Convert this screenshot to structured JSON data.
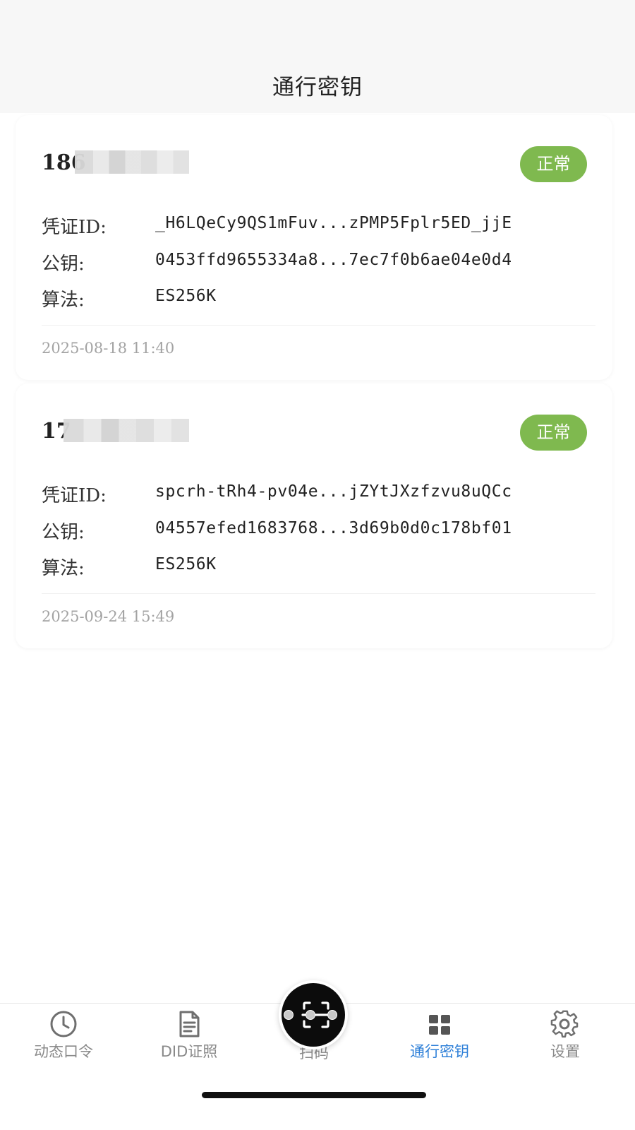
{
  "header": {
    "title": "通行密钥"
  },
  "cards": [
    {
      "account": "186",
      "status": "正常",
      "credential_label": "凭证ID:",
      "credential_id": "_H6LQeCy9QS1mFuv...zPMP5Fplr5ED_jjE",
      "pubkey_label": "公钥:",
      "pubkey": "0453ffd9655334a8...7ec7f0b6ae04e0d4",
      "algo_label": "算法:",
      "algo": "ES256K",
      "timestamp": "2025-08-18 11:40"
    },
    {
      "account": "17",
      "status": "正常",
      "credential_label": "凭证ID:",
      "credential_id": "spcrh-tRh4-pv04e...jZYtJXzfzvu8uQCc",
      "pubkey_label": "公钥:",
      "pubkey": "04557efed1683768...3d69b0d0c178bf01",
      "algo_label": "算法:",
      "algo": "ES256K",
      "timestamp": "2025-09-24 15:49"
    }
  ],
  "tabbar": {
    "items": [
      {
        "label": "动态口令",
        "icon": "clock-icon",
        "active": false
      },
      {
        "label": "DID证照",
        "icon": "document-icon",
        "active": false
      },
      {
        "label": "扫码",
        "icon": "scan-icon",
        "active": false
      },
      {
        "label": "通行密钥",
        "icon": "grid-icon",
        "active": true
      },
      {
        "label": "设置",
        "icon": "gear-icon",
        "active": false
      }
    ]
  },
  "colors": {
    "status_badge": "#7fb94f",
    "active_tab": "#2f80d8",
    "inactive_tab": "#8a8a8a",
    "scan_button": "#0c0c0c"
  }
}
